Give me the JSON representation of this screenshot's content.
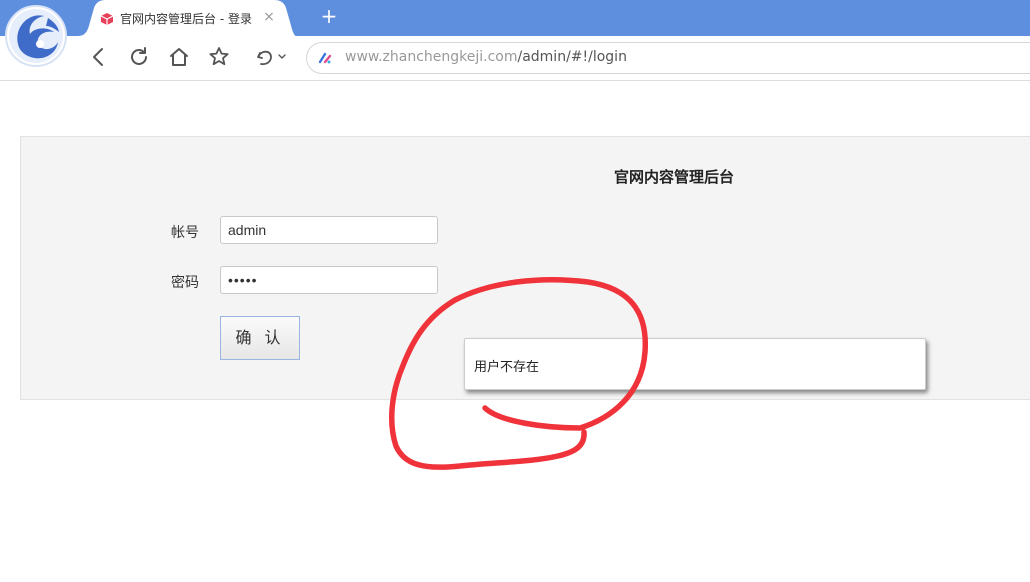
{
  "browser": {
    "tab": {
      "title": "官网内容管理后台 - 登录",
      "close_glyph": "×",
      "favicon": "red-box-icon"
    },
    "new_tab_glyph": "+",
    "address": {
      "host": "www.zhanchengkeji.com",
      "path": "/admin/#!/login"
    },
    "icons": [
      "browser-logo-icon",
      "back-icon",
      "reload-icon",
      "home-icon",
      "star-icon",
      "undo-icon",
      "site-info-icon"
    ],
    "tabstrip_color": "#5e8fde"
  },
  "page": {
    "title": "官网内容管理后台",
    "form": {
      "username_label": "帐号",
      "username_value": "admin",
      "password_label": "密码",
      "password_value": "•••••",
      "submit_label": "确 认"
    },
    "toast": {
      "message": "用户不存在"
    }
  },
  "annotation": {
    "color": "#f0333a"
  }
}
